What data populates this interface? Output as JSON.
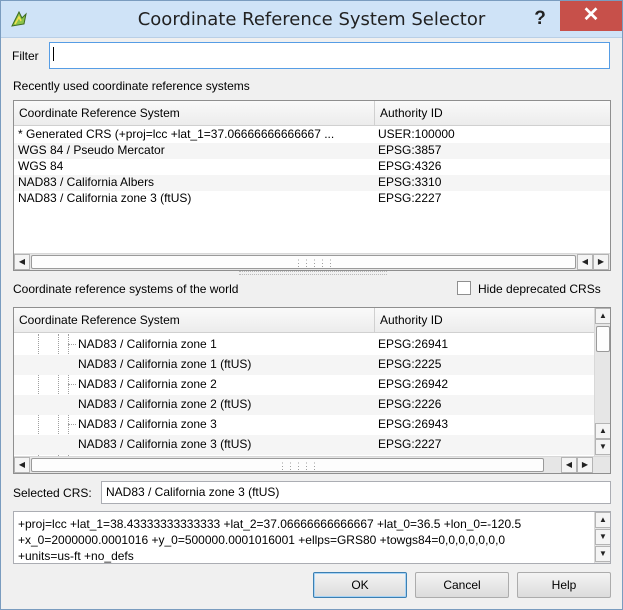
{
  "window": {
    "title": "Coordinate Reference System Selector",
    "help_glyph": "?",
    "close_glyph": "✕"
  },
  "filter": {
    "label": "Filter",
    "value": ""
  },
  "recent": {
    "label": "Recently used coordinate reference systems",
    "columns": [
      "Coordinate Reference System",
      "Authority ID"
    ],
    "rows": [
      {
        "name": " * Generated CRS (+proj=lcc +lat_1=37.06666666666667 ...",
        "id": "USER:100000"
      },
      {
        "name": "WGS 84 / Pseudo Mercator",
        "id": "EPSG:3857"
      },
      {
        "name": "WGS 84",
        "id": "EPSG:4326"
      },
      {
        "name": "NAD83 / California Albers",
        "id": "EPSG:3310"
      },
      {
        "name": "NAD83 / California zone 3 (ftUS)",
        "id": "EPSG:2227"
      }
    ]
  },
  "world": {
    "label": "Coordinate reference systems of the world",
    "hide_deprecated_label": "Hide deprecated CRSs",
    "hide_deprecated_checked": false,
    "columns": [
      "Coordinate Reference System",
      "Authority ID"
    ],
    "rows": [
      {
        "name": "NAD83 / California zone 1",
        "id": "EPSG:26941"
      },
      {
        "name": "NAD83 / California zone 1 (ftUS)",
        "id": "EPSG:2225"
      },
      {
        "name": "NAD83 / California zone 2",
        "id": "EPSG:26942"
      },
      {
        "name": "NAD83 / California zone 2 (ftUS)",
        "id": "EPSG:2226"
      },
      {
        "name": "NAD83 / California zone 3",
        "id": "EPSG:26943"
      },
      {
        "name": "NAD83 / California zone 3 (ftUS)",
        "id": "EPSG:2227"
      }
    ]
  },
  "selected": {
    "label": "Selected CRS:",
    "value": "NAD83 / California zone 3 (ftUS)"
  },
  "proj": {
    "lines": [
      "+proj=lcc +lat_1=38.43333333333333 +lat_2=37.06666666666667 +lat_0=36.5 +lon_0=-120.5",
      "+x_0=2000000.0001016 +y_0=500000.0001016001 +ellps=GRS80 +towgs84=0,0,0,0,0,0,0",
      "+units=us-ft +no_defs"
    ]
  },
  "buttons": {
    "ok": "OK",
    "cancel": "Cancel",
    "help": "Help"
  },
  "icons": {
    "scroll_left": "◀",
    "scroll_right": "▶",
    "scroll_up": "▲",
    "scroll_down": "▼",
    "grip": "⋮⋮⋮⋮⋮"
  },
  "colors": {
    "titlebar": "#cfe3f7",
    "close": "#c7504a",
    "focus_border": "#569de5"
  }
}
